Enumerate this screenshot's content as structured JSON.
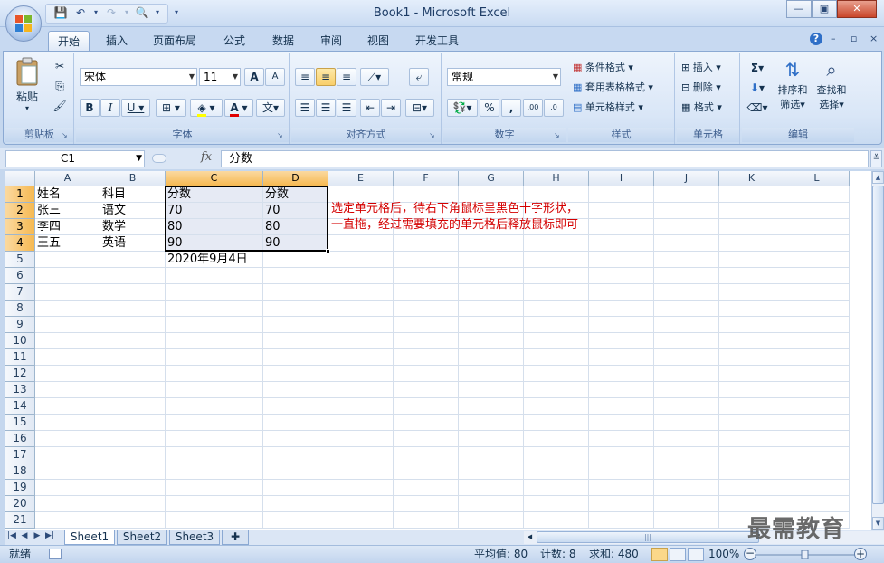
{
  "window": {
    "title": "Book1 - Microsoft Excel",
    "minimize_label": "—",
    "restore_label": "▣",
    "close_label": "✕",
    "ribbon_minimize": "–",
    "ribbon_restore": "▫",
    "ribbon_close": "×",
    "help": "?"
  },
  "tabs": [
    "开始",
    "插入",
    "页面布局",
    "公式",
    "数据",
    "审阅",
    "视图",
    "开发工具"
  ],
  "ribbon": {
    "clipboard": {
      "label": "剪贴板",
      "paste": "粘贴"
    },
    "font": {
      "label": "字体",
      "name": "宋体",
      "size": "11",
      "bold": "B",
      "italic": "I",
      "underline": "U",
      "grow": "A",
      "shrink": "A",
      "phonetic": "文"
    },
    "alignment": {
      "label": "对齐方式"
    },
    "number": {
      "label": "数字",
      "format": "常规",
      "percent": "%",
      "comma": ",",
      "inc": ".00",
      "dec": ".0"
    },
    "styles": {
      "label": "样式",
      "cond": "条件格式",
      "table": "套用表格格式",
      "cell": "单元格样式"
    },
    "cells": {
      "label": "单元格",
      "insert": "插入",
      "delete": "删除",
      "format": "格式"
    },
    "editing": {
      "label": "编辑",
      "sum": "Σ",
      "sort": "排序和",
      "sort2": "筛选",
      "find": "查找和",
      "find2": "选择"
    }
  },
  "formula_bar": {
    "name_box": "C1",
    "fx": "fx",
    "content": "分数"
  },
  "columns": [
    "A",
    "B",
    "C",
    "D",
    "E",
    "F",
    "G",
    "H",
    "I",
    "J",
    "K",
    "L"
  ],
  "selected_columns": [
    "C",
    "D"
  ],
  "rows": [
    "1",
    "2",
    "3",
    "4",
    "5",
    "6",
    "7",
    "8",
    "9",
    "10",
    "11",
    "12",
    "13",
    "14",
    "15",
    "16",
    "17",
    "18",
    "19",
    "20",
    "21"
  ],
  "selected_rows": [
    "1",
    "2",
    "3",
    "4"
  ],
  "cells": {
    "A1": "姓名",
    "B1": "科目",
    "C1": "分数",
    "D1": "分数",
    "A2": "张三",
    "B2": "语文",
    "C2": "70",
    "D2": "70",
    "A3": "李四",
    "B3": "数学",
    "C3": "80",
    "D3": "80",
    "A4": "王五",
    "B4": "英语",
    "C4": "90",
    "D4": "90",
    "C5": "2020年9月4日"
  },
  "note": {
    "line1": "选定单元格后，待右下角鼠标呈黑色十字形状，",
    "line2": "一直拖，经过需要填充的单元格后释放鼠标即可"
  },
  "sheets": [
    "Sheet1",
    "Sheet2",
    "Sheet3"
  ],
  "active_sheet": "Sheet1",
  "status": {
    "mode": "就绪",
    "average": "平均值: 80",
    "count": "计数: 8",
    "sum": "求和: 480",
    "zoom": "100%"
  },
  "watermark": "最需教育",
  "colors": {
    "note": "#d40000",
    "selection_fill": "#e6eaf4",
    "header_selected": "#f6b952"
  }
}
